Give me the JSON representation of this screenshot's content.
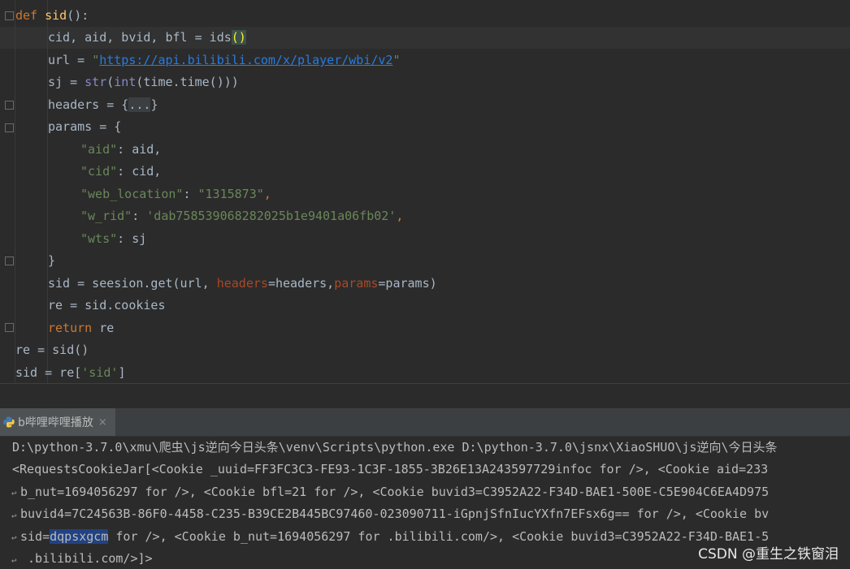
{
  "editor": {
    "lines": [
      [
        "def",
        " ",
        "sid",
        "():"
      ],
      [
        "cid, aid, bvid, bfl = ids",
        "()"
      ],
      [
        "url = ",
        "\"",
        "https://api.bilibili.com/x/player/wbi/v2",
        "\""
      ],
      [
        "sj = ",
        "str",
        "(",
        "int",
        "(time.time()))"
      ],
      [
        "headers = {",
        "...",
        "}"
      ],
      [
        "params = {"
      ],
      [
        "\"aid\"",
        ": aid,"
      ],
      [
        "\"cid\"",
        ": cid,"
      ],
      [
        "\"web_location\"",
        ": ",
        "\"1315873\"",
        ","
      ],
      [
        "\"w_rid\"",
        ": ",
        "'dab758539068282025b1e9401a06fb02'",
        ","
      ],
      [
        "\"wts\"",
        ": sj"
      ],
      [
        "}"
      ],
      [
        "sid = seesion.get(url, ",
        "headers",
        "=headers,",
        "params",
        "=params)"
      ],
      [
        "re = sid.cookies"
      ],
      [
        "return",
        " re"
      ],
      [
        "re = sid()"
      ],
      [
        "sid = re[",
        "'sid'",
        "]"
      ]
    ]
  },
  "run_panel": {
    "tab_label": "b哔哩哔哩播放",
    "close_glyph": "×",
    "icon": "python-icon"
  },
  "console": {
    "lines": [
      "D:\\python-3.7.0\\xmu\\爬虫\\js逆向今日头条\\venv\\Scripts\\python.exe D:\\python-3.7.0\\jsnx\\XiaoSHUO\\js逆向\\今日头条",
      "<RequestsCookieJar[<Cookie _uuid=FF3FC3C3-FE93-1C3F-1855-3B26E13A243597729infoc for />, <Cookie aid=233",
      "b_nut=1694056297 for />, <Cookie bfl=21 for />, <Cookie buvid3=C3952A22-F34D-BAE1-500E-C5E904C6EA4D975",
      "buvid4=7C24563B-86F0-4458-C235-B39CE2B445BC97460-023090711-iGpnjSfnIucYXfn7EFsx6g== for />, <Cookie bv",
      "sid=",
      "dqpsxgcm",
      " for />, <Cookie b_nut=1694056297 for .bilibili.com/>, <Cookie buvid3=C3952A22-F34D-BAE1-5",
      " .bilibili.com/>]>"
    ]
  },
  "watermark": "CSDN @重生之铁窗泪"
}
